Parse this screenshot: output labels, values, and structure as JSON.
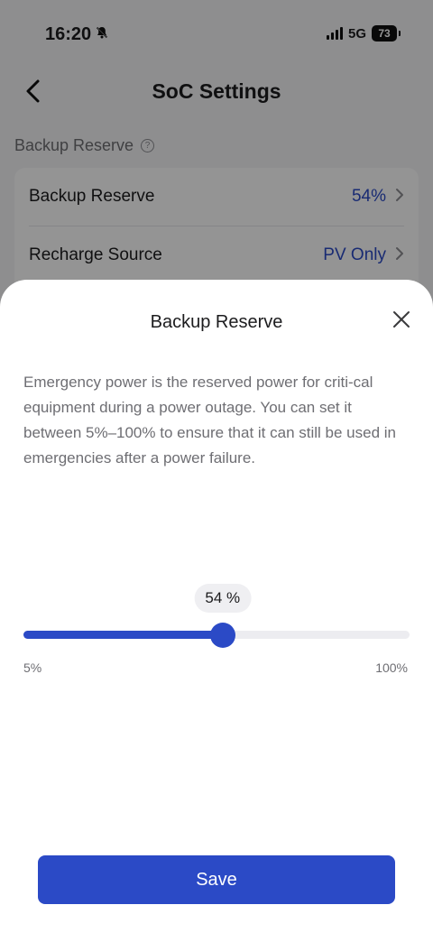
{
  "status_bar": {
    "time": "16:20",
    "network": "5G",
    "battery": "73",
    "icons": [
      "bell-slash-icon",
      "signal-icon",
      "battery-icon"
    ]
  },
  "page": {
    "title": "SoC Settings",
    "back_icon": "chevron-left-icon",
    "section_label": "Backup Reserve",
    "section_help_icon": "question-circle-icon",
    "rows": [
      {
        "label": "Backup Reserve",
        "value": "54%",
        "icon": "chevron-right-icon"
      },
      {
        "label": "Recharge Source",
        "value": "PV Only",
        "icon": "chevron-right-icon"
      }
    ]
  },
  "sheet": {
    "title": "Backup Reserve",
    "close_icon": "close-icon",
    "description": "Emergency power is the reserved power for criti-cal equipment during a power outage. You can set it between 5%–100% to ensure that it can still be used in emergencies after a power failure.",
    "slider": {
      "value_label": "54 %",
      "value": 54,
      "min": 5,
      "max": 100,
      "min_label": "5%",
      "max_label": "100%"
    },
    "save_label": "Save"
  },
  "colors": {
    "accent": "#2b4ac6",
    "track": "#ececf0",
    "overlay": "rgba(0,0,0,0.42)"
  }
}
